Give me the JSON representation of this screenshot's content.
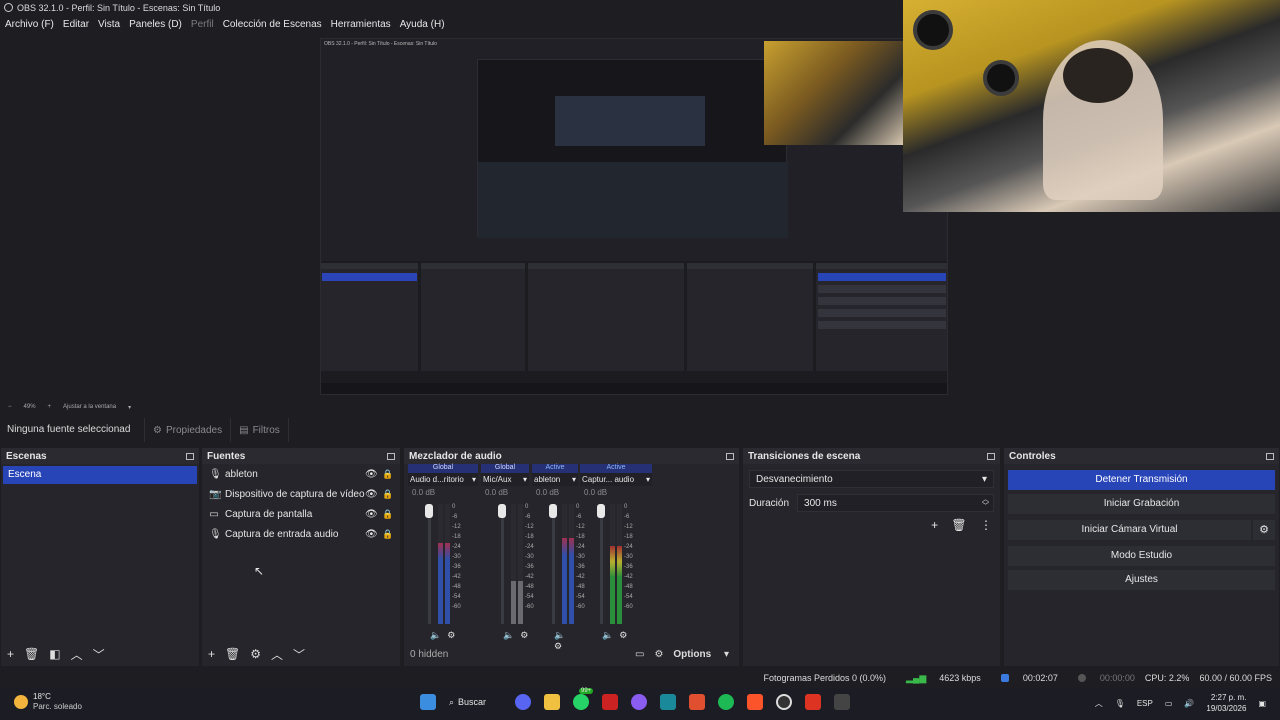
{
  "window": {
    "title": "OBS 32.1.0 - Perfil: Sin Título - Escenas: Sin Título"
  },
  "menu": [
    {
      "label": "Archivo (F)",
      "enabled": true
    },
    {
      "label": "Editar",
      "enabled": true
    },
    {
      "label": "Vista",
      "enabled": true
    },
    {
      "label": "Paneles (D)",
      "enabled": true
    },
    {
      "label": "Perfil",
      "enabled": false
    },
    {
      "label": "Colección de Escenas",
      "enabled": true
    },
    {
      "label": "Herramientas",
      "enabled": true
    },
    {
      "label": "Ayuda (H)",
      "enabled": true
    }
  ],
  "zoom": {
    "minus": "−",
    "value": "49%",
    "plus": "+",
    "fit": "Ajustar a la ventana"
  },
  "source_bar": {
    "no_source": "Ninguna fuente seleccionad",
    "properties": "Propiedades",
    "filters": "Filtros"
  },
  "scenes": {
    "title": "Escenas",
    "items": [
      "Escena"
    ]
  },
  "sources": {
    "title": "Fuentes",
    "items": [
      {
        "label": "ableton",
        "icon": "microphone-icon"
      },
      {
        "label": "Dispositivo de captura de vídeo",
        "icon": "camera-icon"
      },
      {
        "label": "Captura de pantalla",
        "icon": "monitor-icon"
      },
      {
        "label": "Captura de entrada audio",
        "icon": "microphone-icon"
      }
    ]
  },
  "mixer": {
    "title": "Mezclador de audio",
    "channels": [
      {
        "group": "Global",
        "name": "Audio d...ritorio",
        "db": "0.0 dB",
        "level": 0.75
      },
      {
        "group": "Global",
        "name": "Mic/Aux",
        "db": "0.0 dB",
        "level": 0.4,
        "muted": true
      },
      {
        "group": "Active",
        "name": "ableton",
        "db": "0.0 dB",
        "level": 0.8
      },
      {
        "group": "Active",
        "name": "Captur... audio",
        "db": "0.0 dB",
        "level": 0.72
      }
    ],
    "scale": [
      "0",
      "-6",
      "-12",
      "-18",
      "-24",
      "-30",
      "-36",
      "-42",
      "-48",
      "-54",
      "-60"
    ],
    "hidden": "0 hidden",
    "options": "Options"
  },
  "transitions": {
    "title": "Transiciones de escena",
    "selected": "Desvanecimiento",
    "duration_label": "Duración",
    "duration": "300 ms"
  },
  "controls": {
    "title": "Controles",
    "stop_stream": "Detener Transmisión",
    "start_recording": "Iniciar Grabación",
    "start_virtual_cam": "Iniciar Cámara Virtual",
    "studio_mode": "Modo Estudio",
    "settings": "Ajustes"
  },
  "status": {
    "dropped": "Fotogramas Perdidos 0 (0.0%)",
    "bitrate": "4623 kbps",
    "stream_time": "00:02:07",
    "rec_time": "00:00:00",
    "cpu": "CPU: 2.2%",
    "fps": "60.00 / 60.00 FPS"
  },
  "taskbar": {
    "temperature": "18°C",
    "weather": "Parc. soleado",
    "search": "Buscar",
    "badge": "99+",
    "lang": "ESP",
    "time": "2:27 p. m.",
    "date": "19/03/2026"
  },
  "colors": {
    "accent": "#2845b8",
    "bg": "#1d1d22",
    "dock": "#25252b"
  }
}
